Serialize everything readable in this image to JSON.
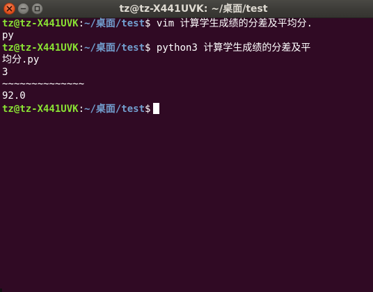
{
  "window": {
    "title": "tz@tz-X441UVK: ~/桌面/test"
  },
  "terminal": {
    "lines": [
      {
        "user": "tz@tz-X441UVK",
        "colon": ":",
        "path": "~/桌面/test",
        "prompt": "$ ",
        "text": "vim 计算学生成绩的分差及平均分."
      },
      {
        "text": "py"
      },
      {
        "user": "tz@tz-X441UVK",
        "colon": ":",
        "path": "~/桌面/test",
        "prompt": "$ ",
        "text": "python3 计算学生成绩的分差及平"
      },
      {
        "text": "均分.py"
      },
      {
        "text": "3"
      },
      {
        "text": "~~~~~~~~~~~~~~"
      },
      {
        "text": "92.0"
      },
      {
        "user": "tz@tz-X441UVK",
        "colon": ":",
        "path": "~/桌面/test",
        "prompt": "$",
        "text": ""
      }
    ]
  },
  "colors": {
    "background": "#300a24",
    "user": "#8ae234",
    "path": "#729fcf",
    "text": "#ffffff"
  },
  "icons": {
    "close": "close-icon",
    "minimize": "minimize-icon",
    "maximize": "maximize-icon"
  }
}
